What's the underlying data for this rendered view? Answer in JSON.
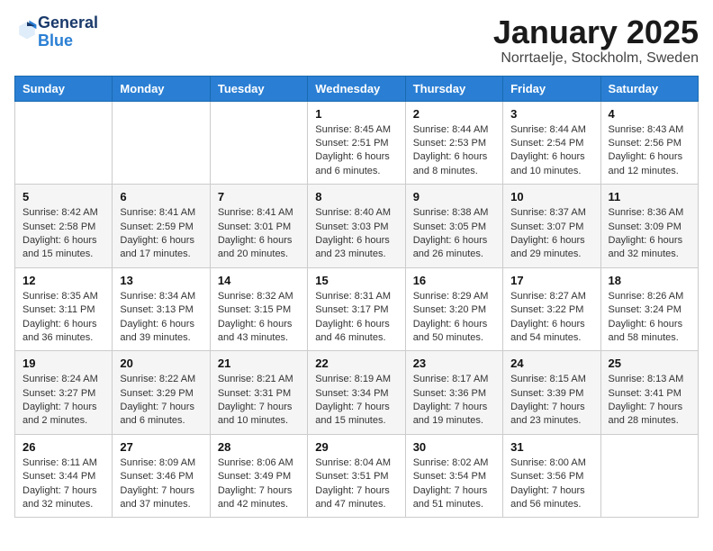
{
  "header": {
    "logo_general": "General",
    "logo_blue": "Blue",
    "month_title": "January 2025",
    "location": "Norrtaelje, Stockholm, Sweden"
  },
  "weekdays": [
    "Sunday",
    "Monday",
    "Tuesday",
    "Wednesday",
    "Thursday",
    "Friday",
    "Saturday"
  ],
  "weeks": [
    [
      {
        "day": "",
        "info": ""
      },
      {
        "day": "",
        "info": ""
      },
      {
        "day": "",
        "info": ""
      },
      {
        "day": "1",
        "info": "Sunrise: 8:45 AM\nSunset: 2:51 PM\nDaylight: 6 hours and 6 minutes."
      },
      {
        "day": "2",
        "info": "Sunrise: 8:44 AM\nSunset: 2:53 PM\nDaylight: 6 hours and 8 minutes."
      },
      {
        "day": "3",
        "info": "Sunrise: 8:44 AM\nSunset: 2:54 PM\nDaylight: 6 hours and 10 minutes."
      },
      {
        "day": "4",
        "info": "Sunrise: 8:43 AM\nSunset: 2:56 PM\nDaylight: 6 hours and 12 minutes."
      }
    ],
    [
      {
        "day": "5",
        "info": "Sunrise: 8:42 AM\nSunset: 2:58 PM\nDaylight: 6 hours and 15 minutes."
      },
      {
        "day": "6",
        "info": "Sunrise: 8:41 AM\nSunset: 2:59 PM\nDaylight: 6 hours and 17 minutes."
      },
      {
        "day": "7",
        "info": "Sunrise: 8:41 AM\nSunset: 3:01 PM\nDaylight: 6 hours and 20 minutes."
      },
      {
        "day": "8",
        "info": "Sunrise: 8:40 AM\nSunset: 3:03 PM\nDaylight: 6 hours and 23 minutes."
      },
      {
        "day": "9",
        "info": "Sunrise: 8:38 AM\nSunset: 3:05 PM\nDaylight: 6 hours and 26 minutes."
      },
      {
        "day": "10",
        "info": "Sunrise: 8:37 AM\nSunset: 3:07 PM\nDaylight: 6 hours and 29 minutes."
      },
      {
        "day": "11",
        "info": "Sunrise: 8:36 AM\nSunset: 3:09 PM\nDaylight: 6 hours and 32 minutes."
      }
    ],
    [
      {
        "day": "12",
        "info": "Sunrise: 8:35 AM\nSunset: 3:11 PM\nDaylight: 6 hours and 36 minutes."
      },
      {
        "day": "13",
        "info": "Sunrise: 8:34 AM\nSunset: 3:13 PM\nDaylight: 6 hours and 39 minutes."
      },
      {
        "day": "14",
        "info": "Sunrise: 8:32 AM\nSunset: 3:15 PM\nDaylight: 6 hours and 43 minutes."
      },
      {
        "day": "15",
        "info": "Sunrise: 8:31 AM\nSunset: 3:17 PM\nDaylight: 6 hours and 46 minutes."
      },
      {
        "day": "16",
        "info": "Sunrise: 8:29 AM\nSunset: 3:20 PM\nDaylight: 6 hours and 50 minutes."
      },
      {
        "day": "17",
        "info": "Sunrise: 8:27 AM\nSunset: 3:22 PM\nDaylight: 6 hours and 54 minutes."
      },
      {
        "day": "18",
        "info": "Sunrise: 8:26 AM\nSunset: 3:24 PM\nDaylight: 6 hours and 58 minutes."
      }
    ],
    [
      {
        "day": "19",
        "info": "Sunrise: 8:24 AM\nSunset: 3:27 PM\nDaylight: 7 hours and 2 minutes."
      },
      {
        "day": "20",
        "info": "Sunrise: 8:22 AM\nSunset: 3:29 PM\nDaylight: 7 hours and 6 minutes."
      },
      {
        "day": "21",
        "info": "Sunrise: 8:21 AM\nSunset: 3:31 PM\nDaylight: 7 hours and 10 minutes."
      },
      {
        "day": "22",
        "info": "Sunrise: 8:19 AM\nSunset: 3:34 PM\nDaylight: 7 hours and 15 minutes."
      },
      {
        "day": "23",
        "info": "Sunrise: 8:17 AM\nSunset: 3:36 PM\nDaylight: 7 hours and 19 minutes."
      },
      {
        "day": "24",
        "info": "Sunrise: 8:15 AM\nSunset: 3:39 PM\nDaylight: 7 hours and 23 minutes."
      },
      {
        "day": "25",
        "info": "Sunrise: 8:13 AM\nSunset: 3:41 PM\nDaylight: 7 hours and 28 minutes."
      }
    ],
    [
      {
        "day": "26",
        "info": "Sunrise: 8:11 AM\nSunset: 3:44 PM\nDaylight: 7 hours and 32 minutes."
      },
      {
        "day": "27",
        "info": "Sunrise: 8:09 AM\nSunset: 3:46 PM\nDaylight: 7 hours and 37 minutes."
      },
      {
        "day": "28",
        "info": "Sunrise: 8:06 AM\nSunset: 3:49 PM\nDaylight: 7 hours and 42 minutes."
      },
      {
        "day": "29",
        "info": "Sunrise: 8:04 AM\nSunset: 3:51 PM\nDaylight: 7 hours and 47 minutes."
      },
      {
        "day": "30",
        "info": "Sunrise: 8:02 AM\nSunset: 3:54 PM\nDaylight: 7 hours and 51 minutes."
      },
      {
        "day": "31",
        "info": "Sunrise: 8:00 AM\nSunset: 3:56 PM\nDaylight: 7 hours and 56 minutes."
      },
      {
        "day": "",
        "info": ""
      }
    ]
  ]
}
